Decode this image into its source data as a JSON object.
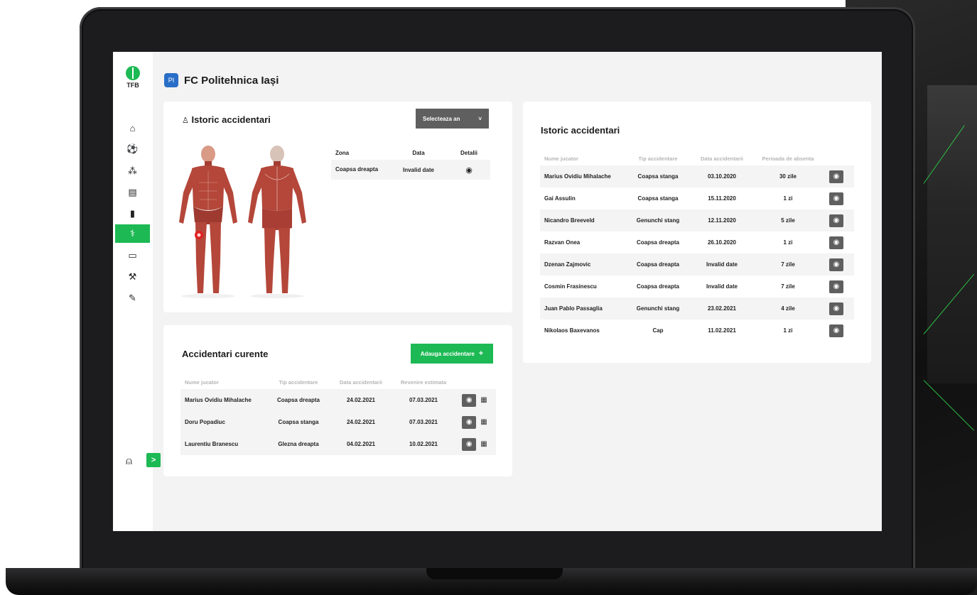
{
  "sidebar": {
    "logo_text": "TFB",
    "items": [
      {
        "icon": "home-icon",
        "glyph": "⌂"
      },
      {
        "icon": "ball-icon",
        "glyph": "⚽"
      },
      {
        "icon": "tactics-icon",
        "glyph": "⁂"
      },
      {
        "icon": "document-icon",
        "glyph": "▤"
      },
      {
        "icon": "stats-icon",
        "glyph": "▮"
      },
      {
        "icon": "medical-icon",
        "glyph": "⚕"
      },
      {
        "icon": "folder-icon",
        "glyph": "▭"
      },
      {
        "icon": "tool-icon",
        "glyph": "⚒"
      },
      {
        "icon": "edit-icon",
        "glyph": "✎"
      }
    ],
    "active_index": 5,
    "expand_glyph": ">",
    "user_glyph": "⍝"
  },
  "header": {
    "club_name": "FC Politehnica Iași",
    "badge": "PI"
  },
  "history_panel": {
    "title": "Istoric accidentari",
    "select_label": "Selecteaza an",
    "select_arrow": "˅",
    "columns": [
      "Zona",
      "Data",
      "Detalii"
    ],
    "rows": [
      {
        "zone": "Coapsa dreapta",
        "date": "Invalid date"
      }
    ]
  },
  "current_panel": {
    "title": "Accidentari curente",
    "add_label": "Adauga accidentare",
    "add_glyph": "+",
    "columns": [
      "Nume jucator",
      "Tip accidentare",
      "Data accidentarii",
      "Revenire estimata"
    ],
    "rows": [
      {
        "name": "Marius Ovidiu Mihalache",
        "type": "Coapsa dreapta",
        "date": "24.02.2021",
        "return": "07.03.2021"
      },
      {
        "name": "Doru Popadiuc",
        "type": "Coapsa stanga",
        "date": "24.02.2021",
        "return": "07.03.2021"
      },
      {
        "name": "Laurentiu Branescu",
        "type": "Glezna dreapta",
        "date": "04.02.2021",
        "return": "10.02.2021"
      }
    ]
  },
  "history_table": {
    "title": "Istoric accidentari",
    "columns": [
      "Nume jucator",
      "Tip accidentare",
      "Data accidentarii",
      "Perioada de absenta"
    ],
    "rows": [
      {
        "name": "Marius Ovidiu Mihalache",
        "type": "Coapsa stanga",
        "date": "03.10.2020",
        "absence": "30 zile"
      },
      {
        "name": "Gai Assulin",
        "type": "Coapsa stanga",
        "date": "15.11.2020",
        "absence": "1 zi"
      },
      {
        "name": "Nicandro Breeveld",
        "type": "Genunchi stang",
        "date": "12.11.2020",
        "absence": "5 zile"
      },
      {
        "name": "Razvan Onea",
        "type": "Coapsa dreapta",
        "date": "26.10.2020",
        "absence": "1 zi"
      },
      {
        "name": "Dzenan Zajmovic",
        "type": "Coapsa dreapta",
        "date": "Invalid date",
        "absence": "7 zile"
      },
      {
        "name": "Cosmin Frasinescu",
        "type": "Coapsa dreapta",
        "date": "Invalid date",
        "absence": "7 zile"
      },
      {
        "name": "Juan Pablo Passaglia",
        "type": "Genunchi stang",
        "date": "23.02.2021",
        "absence": "4 zile"
      },
      {
        "name": "Nikolaos Baxevanos",
        "type": "Cap",
        "date": "11.02.2021",
        "absence": "1 zi"
      }
    ]
  },
  "colors": {
    "accent": "#1db954",
    "button_dark": "#5f5f5f",
    "muscle": "#b4473a"
  }
}
